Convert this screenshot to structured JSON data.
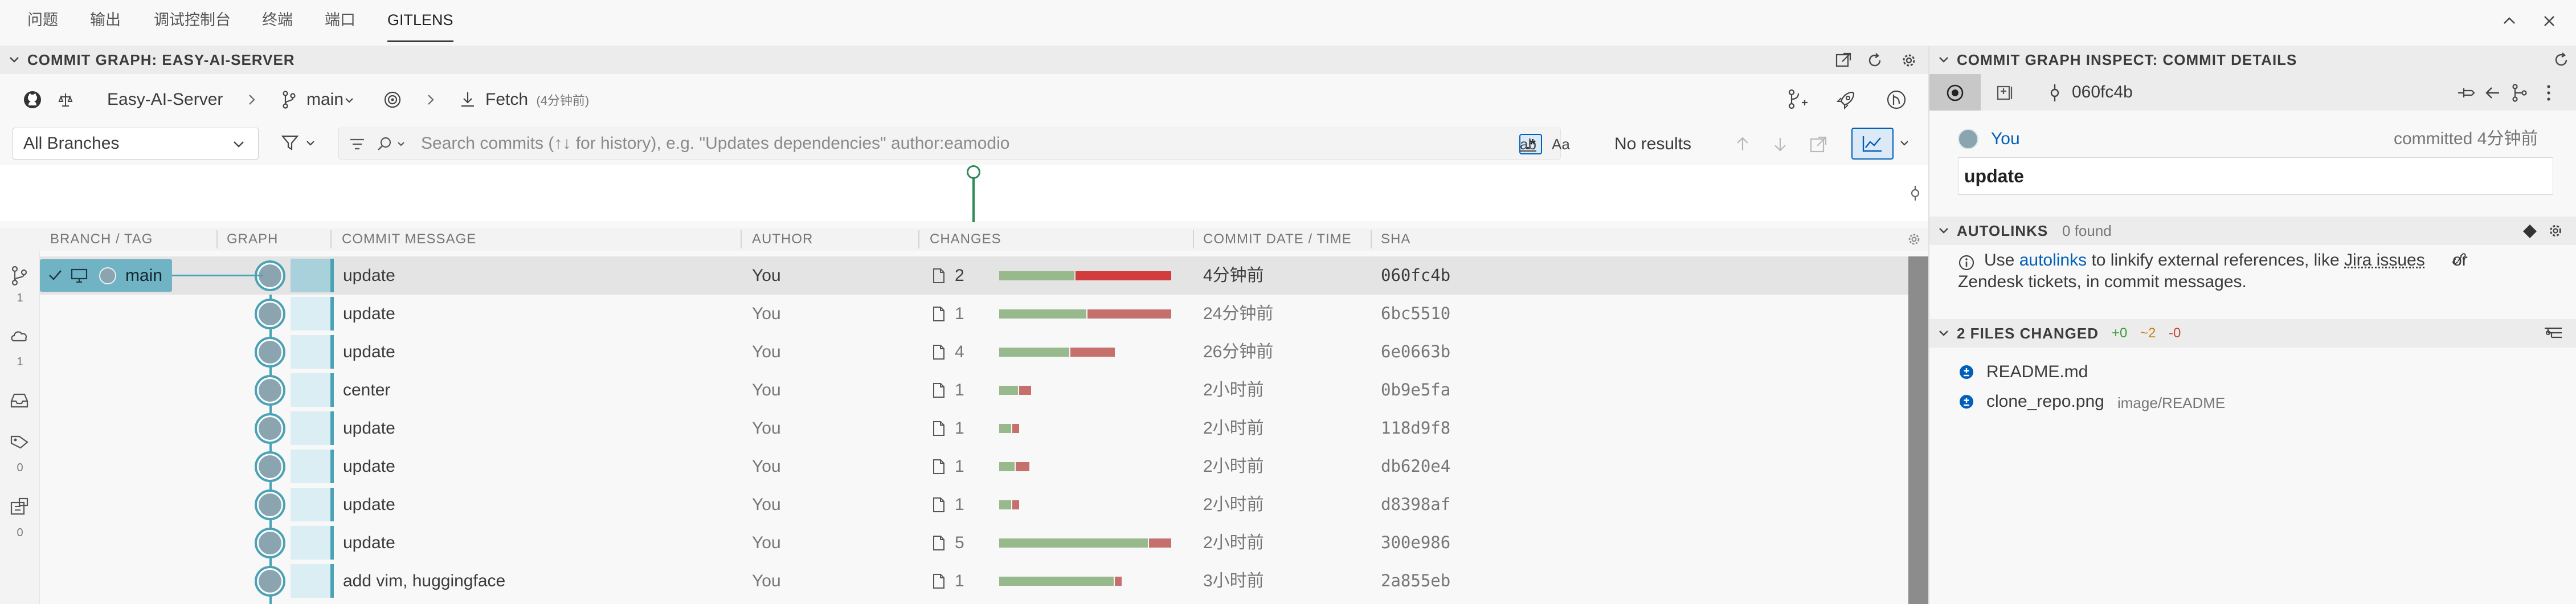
{
  "panel_tabs": [
    "问题",
    "输出",
    "调试控制台",
    "终端",
    "端口",
    "GITLENS"
  ],
  "graph": {
    "section_title": "COMMIT GRAPH: EASY-AI-SERVER",
    "repo": "Easy-AI-Server",
    "branch": "main",
    "fetch_label": "Fetch",
    "fetch_time": "(4分钟前)",
    "branch_filter": "All Branches",
    "search_placeholder": "Search commits (↑↓ for history), e.g. \"Updates dependencies\" author:eamodio",
    "search_opt_ab": "ab",
    "search_opt_aa": "Aa",
    "search_opt_regex": ".*",
    "search_result": "No results",
    "columns": [
      "BRANCH / TAG",
      "GRAPH",
      "COMMIT MESSAGE",
      "AUTHOR",
      "CHANGES",
      "COMMIT DATE / TIME",
      "SHA"
    ],
    "sidebar_counts": [
      "1",
      "1",
      "0",
      "0"
    ],
    "ref_label": "main",
    "rows": [
      {
        "message": "update",
        "author": "You",
        "changes": "2",
        "added": 0.44,
        "removed": 0.56,
        "date": "4分钟前",
        "sha": "060fc4b"
      },
      {
        "message": "update",
        "author": "You",
        "changes": "1",
        "added": 0.51,
        "removed": 0.49,
        "date": "24分钟前",
        "sha": "6bc5510"
      },
      {
        "message": "update",
        "author": "You",
        "changes": "4",
        "added": 0.41,
        "removed": 0.26,
        "date": "26分钟前",
        "sha": "6e0663b"
      },
      {
        "message": "center",
        "author": "You",
        "changes": "1",
        "added": 0.11,
        "removed": 0.07,
        "date": "2小时前",
        "sha": "0b9e5fa"
      },
      {
        "message": "update",
        "author": "You",
        "changes": "1",
        "added": 0.07,
        "removed": 0.04,
        "date": "2小时前",
        "sha": "118d9f8"
      },
      {
        "message": "update",
        "author": "You",
        "changes": "1",
        "added": 0.09,
        "removed": 0.08,
        "date": "2小时前",
        "sha": "db620e4"
      },
      {
        "message": "update",
        "author": "You",
        "changes": "1",
        "added": 0.07,
        "removed": 0.04,
        "date": "2小时前",
        "sha": "d8398af"
      },
      {
        "message": "update",
        "author": "You",
        "changes": "5",
        "added": 0.87,
        "removed": 0.13,
        "date": "2小时前",
        "sha": "300e986"
      },
      {
        "message": "add vim, huggingface",
        "author": "You",
        "changes": "1",
        "added": 0.67,
        "removed": 0.04,
        "date": "3小时前",
        "sha": "2a855eb"
      }
    ]
  },
  "inspect": {
    "section_title": "COMMIT GRAPH INSPECT: COMMIT DETAILS",
    "sha": "060fc4b",
    "author": "You",
    "committed": "committed 4分钟前",
    "message": "update",
    "autolinks_title": "AUTOLINKS",
    "autolinks_found": "0 found",
    "autolinks_text_1": "Use",
    "autolinks_link": "autolinks",
    "autolinks_text_2": "to linkify external references, like",
    "autolinks_jira": "Jira issues",
    "autolinks_text_3": "or",
    "autolinks_text_4": "Zendesk tickets, in commit messages.",
    "files_title": "2 FILES CHANGED",
    "files_added": "+0",
    "files_modified": "~2",
    "files_removed": "-0",
    "files": [
      {
        "name": "README.md",
        "path": ""
      },
      {
        "name": "clone_repo.png",
        "path": "image/README"
      }
    ]
  },
  "colors": {
    "added": "#97b98b",
    "removed": "#c6706e",
    "removed_strong": "#d23c3c",
    "accent": "#005fb8",
    "graph_lane": "#4aa3b5"
  }
}
